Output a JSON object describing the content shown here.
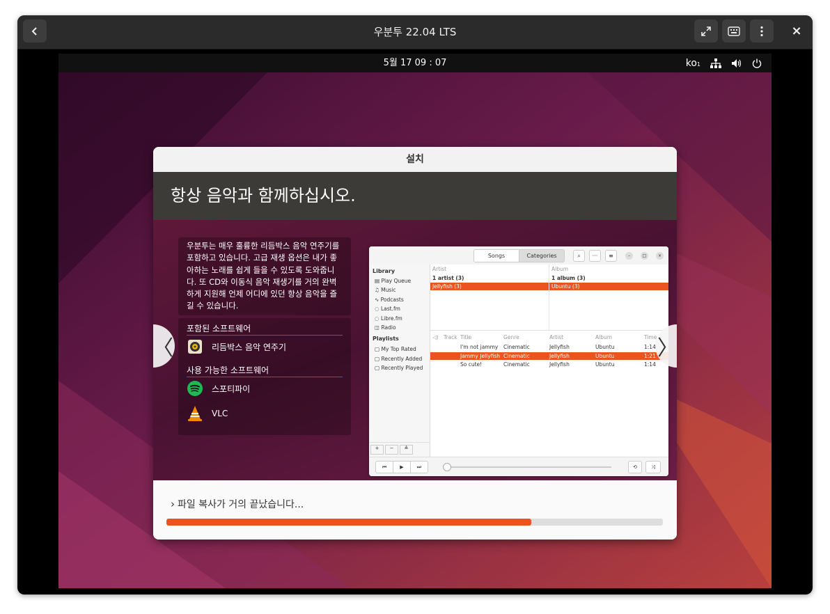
{
  "window": {
    "title": "우분투 22.04 LTS",
    "back_icon": "chevron-left-icon",
    "fullscreen_icon": "fullscreen-icon",
    "keyboard_icon": "keyboard-icon",
    "menu_icon": "kebab-menu-icon",
    "close_label": "×"
  },
  "topbar": {
    "clock": "5월 17  09 : 07",
    "input_method": "ko",
    "input_method_sub": "1"
  },
  "installer": {
    "title": "설치",
    "slide_title": "항상 음악과 함께하십시오.",
    "description": "우분투는 매우 훌륭한 리듬박스 음악 연주기를 포함하고 있습니다. 고급 재생 옵션은 내가 좋아하는 노래를 쉽게 들을 수 있도록 도와줍니다. 또 CD와 이동식 음악 재생기를 거의 완벽하게 지원해 언제 어디에 있던 항상 음악을 즐길 수 있습니다.",
    "included_heading": "포함된 소프트웨어",
    "included": [
      {
        "name": "리듬박스 음악 연주기",
        "icon": "rhythmbox-icon"
      }
    ],
    "available_heading": "사용 가능한 소프트웨어",
    "available": [
      {
        "name": "스포티파이",
        "icon": "spotify-icon"
      },
      {
        "name": "VLC",
        "icon": "vlc-icon"
      }
    ],
    "prev_label": "〈",
    "next_label": "〉",
    "status": "파일 복사가 거의 끝났습니다...",
    "status_prefix": "›",
    "progress_percent": 73.5,
    "accent": "#e95420"
  },
  "rhythmbox": {
    "tabs": [
      "Songs",
      "Categories"
    ],
    "sidebar_library_heading": "Library",
    "sidebar_library": [
      "Play Queue",
      "Music",
      "Podcasts",
      "Last.fm",
      "Libre.fm",
      "Radio"
    ],
    "sidebar_playlists_heading": "Playlists",
    "sidebar_playlists": [
      "My Top Rated",
      "Recently Added",
      "Recently Played"
    ],
    "browser_headers": [
      "Artist",
      "Album"
    ],
    "browser_rows": [
      [
        "1 artist (3)",
        "1 album (3)"
      ],
      [
        "Jellyfish (3)",
        "Ubuntu (3)"
      ]
    ],
    "track_headers": [
      "Track",
      "Title",
      "Genre",
      "Artist",
      "Album",
      "Time"
    ],
    "tracks": [
      {
        "title": "I'm not jammy",
        "genre": "Cinematic",
        "artist": "Jellyfish",
        "album": "Ubuntu",
        "time": "1:14"
      },
      {
        "title": "Jammy Jellyfish",
        "genre": "Cinematic",
        "artist": "Jellyfish",
        "album": "Ubuntu",
        "time": "1:21"
      },
      {
        "title": "So cute!",
        "genre": "Cinematic",
        "artist": "Jellyfish",
        "album": "Ubuntu",
        "time": "1:14"
      }
    ],
    "sidebar_tools": [
      "+",
      "−",
      "≜"
    ],
    "controls": [
      "⏮",
      "▶",
      "⏭"
    ]
  }
}
